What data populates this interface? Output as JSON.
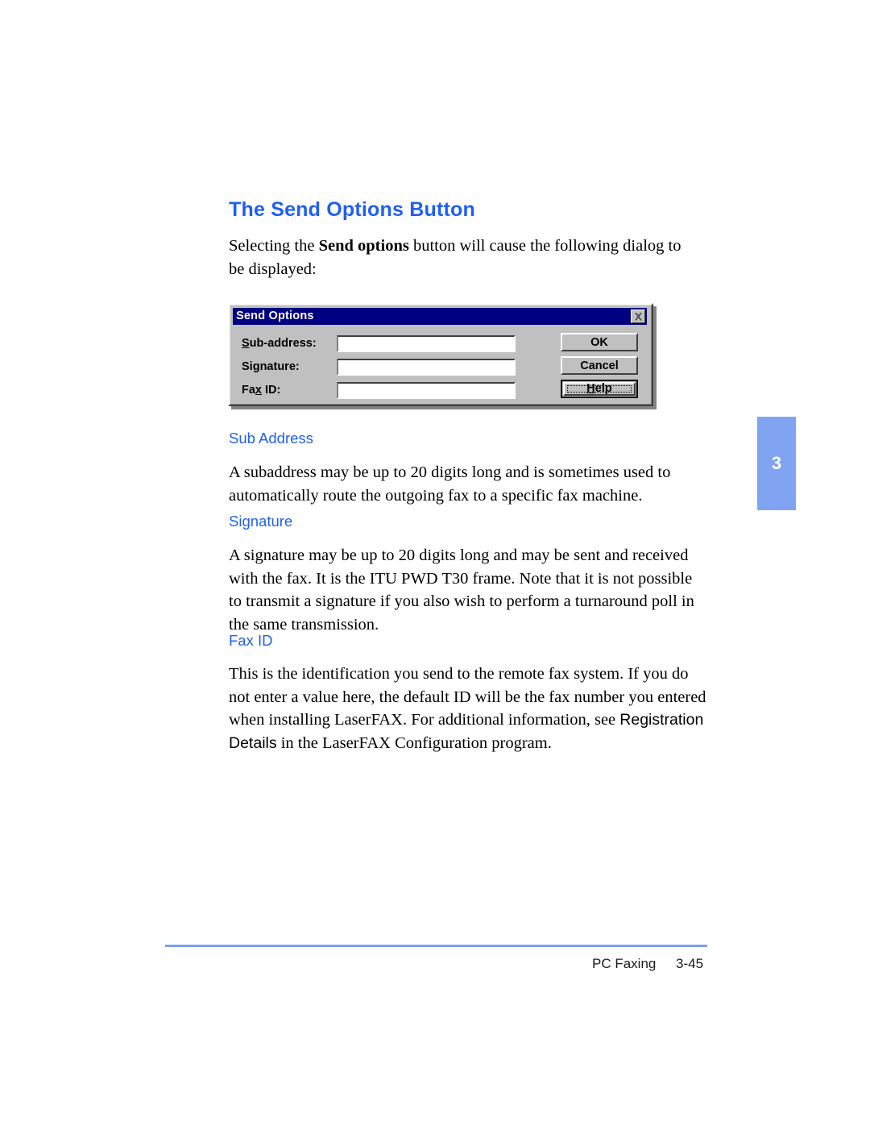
{
  "page": {
    "heading": "The Send Options Button",
    "intro_before": "Selecting the ",
    "intro_bold": "Send options",
    "intro_after": " button will cause the following dialog to be displayed:",
    "chapter_tab": "3",
    "footer_label": "PC Faxing",
    "footer_page": "3-45",
    "accent_blue": "#2160f2",
    "tab_blue": "#80a4f2",
    "rule_blue": "#7f9ef5"
  },
  "dialog": {
    "title": "Send Options",
    "close_icon": "close-x-icon",
    "titlebar_color": "#000080",
    "face_color": "#c0c0c0",
    "fields": [
      {
        "label_pre": "S",
        "label_accel": "",
        "label_rest": "ub-address:",
        "accel_char": "S",
        "value": "",
        "placeholder": ""
      },
      {
        "label_pre": "Si",
        "label_accel": "g",
        "label_rest": "nature:",
        "accel_char": "g",
        "value": "",
        "placeholder": ""
      },
      {
        "label_pre": "Fa",
        "label_accel": "x",
        "label_rest": " ID:",
        "accel_char": "x",
        "value": "",
        "placeholder": ""
      }
    ],
    "buttons": {
      "ok": "OK",
      "cancel": "Cancel",
      "help_pre": "",
      "help_accel": "H",
      "help_rest": "elp"
    }
  },
  "sections": [
    {
      "title": "Sub Address",
      "body": "A subaddress may be up to 20 digits long and is sometimes used to automatically route the outgoing fax to a specific fax machine."
    },
    {
      "title": "Signature",
      "body": "A signature may be up to 20 digits long and may be sent and received with the fax.  It is the ITU PWD T30 frame.  Note that it is not possible to transmit a signature if you also wish to perform a turnaround poll in the same transmission."
    },
    {
      "title": "Fax ID",
      "body_part1": "This is the identification you send to the remote fax system.  If you do not enter a value here, the default ID will be the fax number you entered when installing LaserFAX.  For additional information, see ",
      "body_ref": "Registration Details",
      "body_part2": " in the LaserFAX Configuration program."
    }
  ]
}
